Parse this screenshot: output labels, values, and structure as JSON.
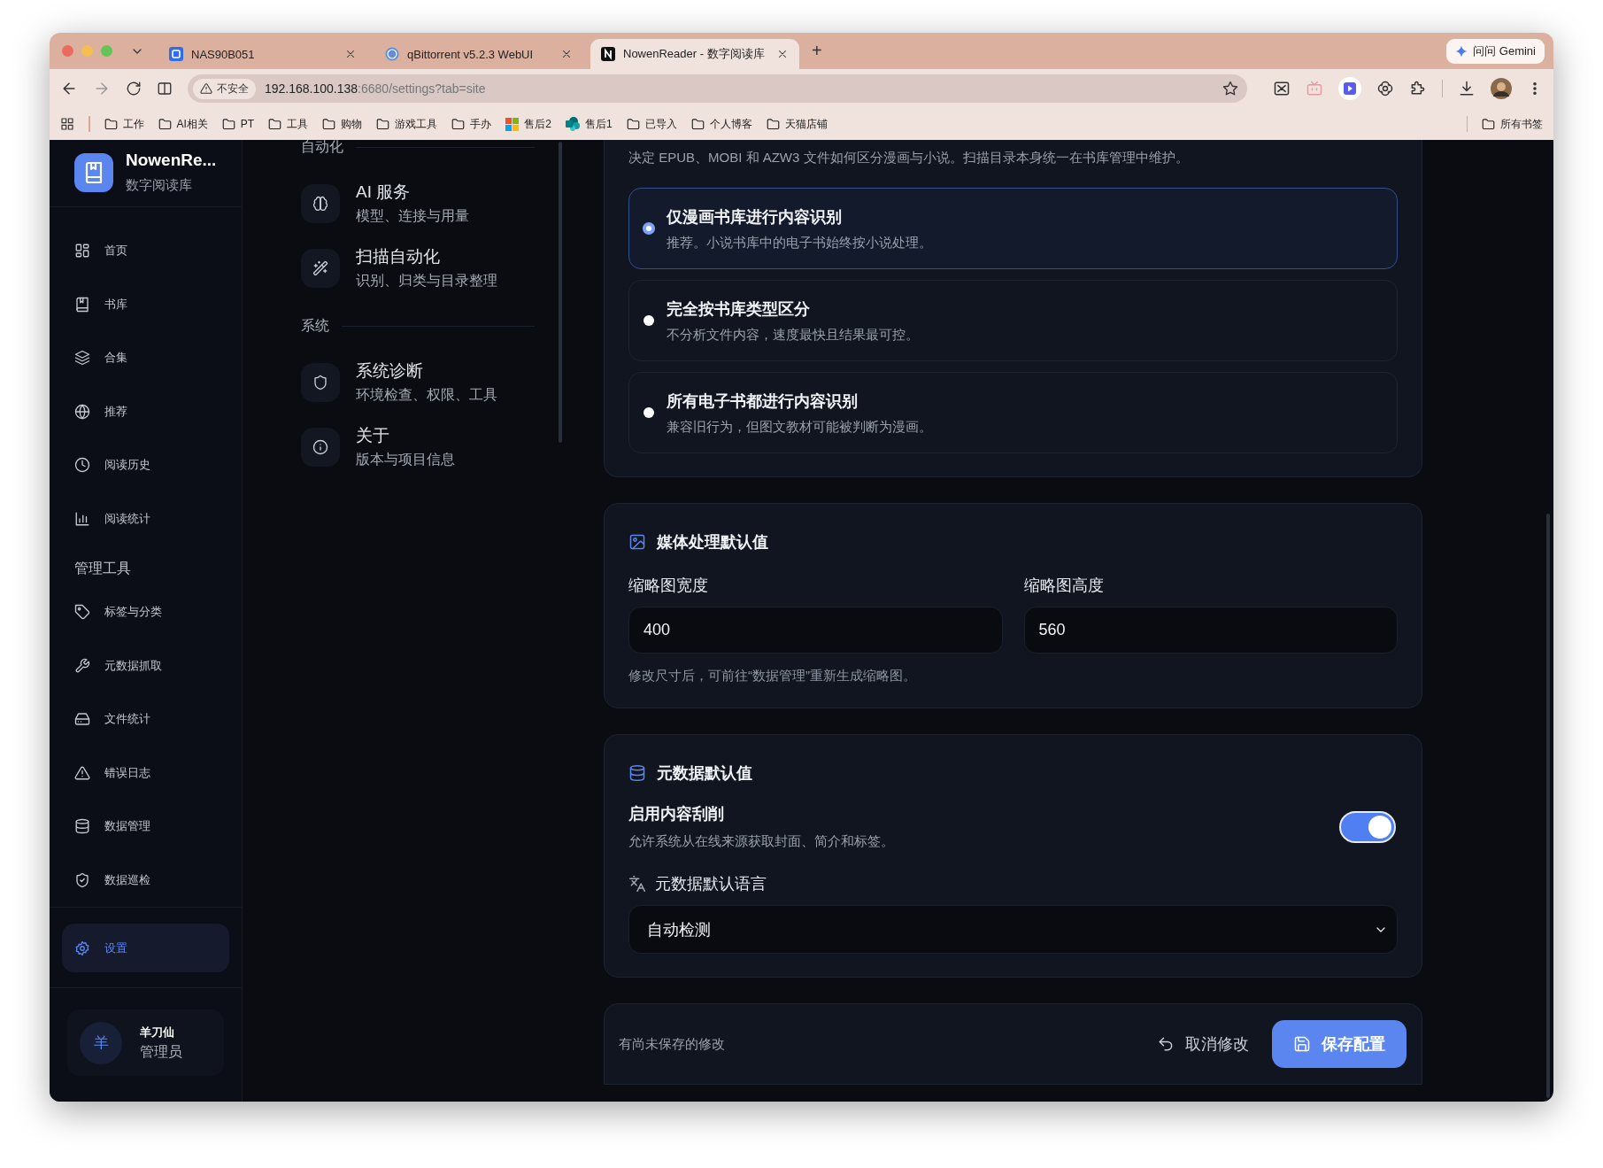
{
  "browser": {
    "tabs": [
      {
        "title": "NAS90B051",
        "kind": "nas",
        "selected": false
      },
      {
        "title": "qBittorrent v5.2.3 WebUI",
        "kind": "qbittorrent",
        "selected": false
      },
      {
        "title": "NowenReader - 数字阅读库",
        "kind": "nowen",
        "selected": true
      }
    ],
    "new_tab": "+",
    "gemini": "问问 Gemini",
    "address": {
      "security": "不安全",
      "host": "192.168.100.138",
      "path": ":6680/settings?tab=site"
    },
    "bookmarks": [
      {
        "label": "工作",
        "kind": "folder"
      },
      {
        "label": "AI相关",
        "kind": "folder"
      },
      {
        "label": "PT",
        "kind": "folder"
      },
      {
        "label": "工具",
        "kind": "folder"
      },
      {
        "label": "购物",
        "kind": "folder"
      },
      {
        "label": "游戏工具",
        "kind": "folder"
      },
      {
        "label": "手办",
        "kind": "folder"
      },
      {
        "label": "售后2",
        "kind": "windows"
      },
      {
        "label": "售后1",
        "kind": "sharepoint"
      },
      {
        "label": "已导入",
        "kind": "folder"
      },
      {
        "label": "个人博客",
        "kind": "folder"
      },
      {
        "label": "天猫店铺",
        "kind": "folder"
      }
    ],
    "all_bookmarks": "所有书签"
  },
  "sidebar": {
    "app_name": "NowenRe...",
    "app_subtitle": "数字阅读库",
    "nav": [
      {
        "label": "首页",
        "kind": "grid",
        "selected": false
      },
      {
        "label": "书库",
        "kind": "book",
        "selected": false
      },
      {
        "label": "合集",
        "kind": "layers",
        "selected": false
      },
      {
        "label": "推荐",
        "kind": "globe",
        "selected": false
      },
      {
        "label": "阅读历史",
        "kind": "clock",
        "selected": false
      },
      {
        "label": "阅读统计",
        "kind": "chart",
        "selected": false
      }
    ],
    "tools_title": "管理工具",
    "tools": [
      {
        "label": "标签与分类",
        "kind": "tag",
        "selected": false
      },
      {
        "label": "元数据抓取",
        "kind": "wrench",
        "selected": false
      },
      {
        "label": "文件统计",
        "kind": "drive",
        "selected": false
      },
      {
        "label": "错误日志",
        "kind": "warning",
        "selected": false
      },
      {
        "label": "数据管理",
        "kind": "database",
        "selected": false
      },
      {
        "label": "数据巡检",
        "kind": "shield-check",
        "selected": false
      }
    ],
    "footer_nav": [
      {
        "label": "设置",
        "kind": "gear",
        "selected": true
      }
    ],
    "user": {
      "avatar": "羊",
      "name": "羊刀仙",
      "role": "管理员"
    }
  },
  "settings_nav": {
    "groups": [
      {
        "title": "自动化",
        "items": [
          {
            "title": "AI 服务",
            "subtitle": "模型、连接与用量",
            "kind": "brain",
            "selected": false
          },
          {
            "title": "扫描自动化",
            "subtitle": "识别、归类与目录整理",
            "kind": "wand",
            "selected": false
          }
        ]
      },
      {
        "title": "系统",
        "items": [
          {
            "title": "系统诊断",
            "subtitle": "环境检查、权限、工具",
            "kind": "shield",
            "selected": false
          },
          {
            "title": "关于",
            "subtitle": "版本与项目信息",
            "kind": "info",
            "selected": false
          }
        ]
      }
    ]
  },
  "recognition": {
    "description": "决定 EPUB、MOBI 和 AZW3 文件如何区分漫画与小说。扫描目录本身统一在书库管理中维护。",
    "options": [
      {
        "title": "仅漫画书库进行内容识别",
        "description": "推荐。小说书库中的电子书始终按小说处理。",
        "selected": true
      },
      {
        "title": "完全按书库类型区分",
        "description": "不分析文件内容，速度最快且结果最可控。",
        "selected": false
      },
      {
        "title": "所有电子书都进行内容识别",
        "description": "兼容旧行为，但图文教材可能被判断为漫画。",
        "selected": false
      }
    ]
  },
  "media": {
    "title": "媒体处理默认值",
    "fields": [
      {
        "label": "缩略图宽度",
        "value": "400"
      },
      {
        "label": "缩略图高度",
        "value": "560"
      }
    ],
    "hint": "修改尺寸后，可前往“数据管理”重新生成缩略图。"
  },
  "metadata": {
    "title": "元数据默认值",
    "toggle": {
      "label": "启用内容刮削",
      "description": "允许系统从在线来源获取封面、简介和标签。",
      "on": true
    },
    "language": {
      "label": "元数据默认语言",
      "value": "自动检测"
    }
  },
  "footer": {
    "message": "有尚未保存的修改",
    "cancel": "取消修改",
    "save": "保存配置"
  }
}
